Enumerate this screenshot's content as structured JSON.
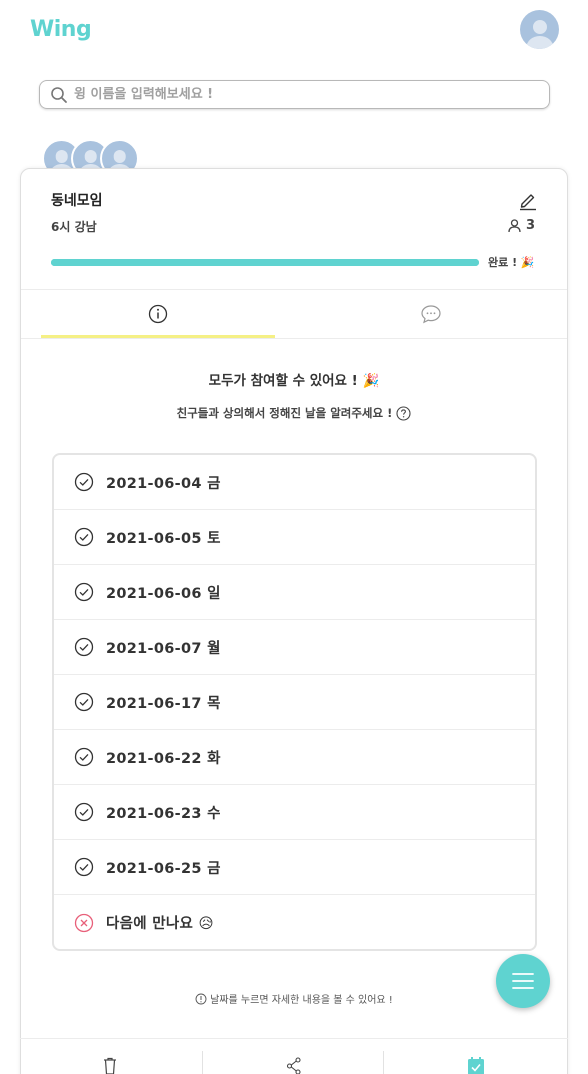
{
  "app": {
    "logo": "Wing"
  },
  "search": {
    "placeholder": "윙 이름을 입력해보세요 !"
  },
  "group": {
    "name": "동네모임",
    "subtitle": "6시 강남",
    "member_count": "3",
    "progress_fraction": 1.0,
    "progress_label": "완료 ! 🎉"
  },
  "tabs": [
    {
      "name": "info",
      "icon": "info-icon",
      "active": true
    },
    {
      "name": "chat",
      "icon": "chat-bubble-icon",
      "active": false
    }
  ],
  "content": {
    "headline": "모두가 참여할 수 있어요 ! 🎉",
    "subline": "친구들과 상의해서 정해진 날을 알려주세요 !"
  },
  "dates": [
    {
      "label": "2021-06-04 금",
      "icon": "check-circle-icon"
    },
    {
      "label": "2021-06-05 토",
      "icon": "check-circle-icon"
    },
    {
      "label": "2021-06-06 일",
      "icon": "check-circle-icon"
    },
    {
      "label": "2021-06-07 월",
      "icon": "check-circle-icon"
    },
    {
      "label": "2021-06-17 목",
      "icon": "check-circle-icon"
    },
    {
      "label": "2021-06-22 화",
      "icon": "check-circle-icon"
    },
    {
      "label": "2021-06-23 수",
      "icon": "check-circle-icon"
    },
    {
      "label": "2021-06-25 금",
      "icon": "check-circle-icon"
    },
    {
      "label": "다음에 만나요 😥",
      "icon": "x-circle-icon"
    }
  ],
  "hint": "날짜를 누르면 자세한 내용을 볼 수 있어요 !",
  "colors": {
    "accent": "#5fd3d0",
    "tab_underline": "#f5f085",
    "cancel": "#e8607a",
    "avatar": "#a9c2de"
  },
  "bottom_actions": [
    "trash-icon",
    "share-icon",
    "calendar-check-icon"
  ]
}
